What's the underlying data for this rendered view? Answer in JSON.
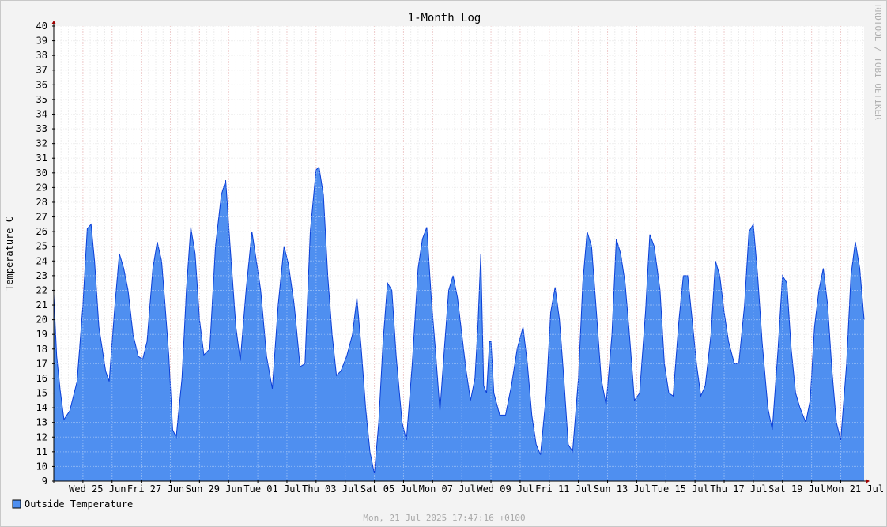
{
  "chart_data": {
    "type": "area",
    "title": "1-Month Log",
    "ylabel": "Temperature C",
    "xlabel": "",
    "ylim": [
      9,
      40
    ],
    "y_ticks": [
      9,
      10,
      11,
      12,
      13,
      14,
      15,
      16,
      17,
      18,
      19,
      20,
      21,
      22,
      23,
      24,
      25,
      26,
      27,
      28,
      29,
      30,
      31,
      32,
      33,
      34,
      35,
      36,
      37,
      38,
      39,
      40
    ],
    "x_range_days": [
      0,
      27.8
    ],
    "x_tick_labels": [
      {
        "day": 1.5,
        "label": "Wed 25 Jun"
      },
      {
        "day": 3.5,
        "label": "Fri 27 Jun"
      },
      {
        "day": 5.5,
        "label": "Sun 29 Jun"
      },
      {
        "day": 7.5,
        "label": "Tue 01 Jul"
      },
      {
        "day": 9.5,
        "label": "Thu 03 Jul"
      },
      {
        "day": 11.5,
        "label": "Sat 05 Jul"
      },
      {
        "day": 13.5,
        "label": "Mon 07 Jul"
      },
      {
        "day": 15.5,
        "label": "Wed 09 Jul"
      },
      {
        "day": 17.5,
        "label": "Fri 11 Jul"
      },
      {
        "day": 19.5,
        "label": "Sun 13 Jul"
      },
      {
        "day": 21.5,
        "label": "Tue 15 Jul"
      },
      {
        "day": 23.5,
        "label": "Thu 17 Jul"
      },
      {
        "day": 25.5,
        "label": "Sat 19 Jul"
      },
      {
        "day": 27.5,
        "label": "Mon 21 Jul"
      }
    ],
    "grid": true,
    "series": [
      {
        "name": "Outside Temperature",
        "color": "#4f8ff0",
        "outline": "#0a3fd8",
        "points": [
          [
            0.0,
            21.7
          ],
          [
            0.1,
            17.5
          ],
          [
            0.22,
            15.2
          ],
          [
            0.35,
            13.2
          ],
          [
            0.55,
            13.8
          ],
          [
            0.8,
            15.8
          ],
          [
            1.0,
            21.0
          ],
          [
            1.15,
            26.2
          ],
          [
            1.28,
            26.5
          ],
          [
            1.4,
            24.0
          ],
          [
            1.55,
            19.5
          ],
          [
            1.78,
            16.5
          ],
          [
            1.9,
            15.8
          ],
          [
            2.1,
            21.0
          ],
          [
            2.25,
            24.5
          ],
          [
            2.4,
            23.5
          ],
          [
            2.55,
            22.0
          ],
          [
            2.72,
            19.0
          ],
          [
            2.9,
            17.5
          ],
          [
            3.05,
            17.3
          ],
          [
            3.2,
            18.5
          ],
          [
            3.4,
            23.5
          ],
          [
            3.55,
            25.3
          ],
          [
            3.7,
            24.0
          ],
          [
            3.82,
            21.0
          ],
          [
            3.95,
            17.5
          ],
          [
            4.08,
            12.5
          ],
          [
            4.2,
            12.0
          ],
          [
            4.4,
            16.0
          ],
          [
            4.55,
            22.0
          ],
          [
            4.7,
            26.3
          ],
          [
            4.85,
            24.5
          ],
          [
            5.0,
            20.0
          ],
          [
            5.15,
            17.6
          ],
          [
            5.35,
            18.0
          ],
          [
            5.55,
            25.0
          ],
          [
            5.75,
            28.5
          ],
          [
            5.9,
            29.5
          ],
          [
            6.05,
            25.0
          ],
          [
            6.25,
            19.5
          ],
          [
            6.4,
            17.2
          ],
          [
            6.6,
            22.0
          ],
          [
            6.8,
            26.0
          ],
          [
            6.95,
            24.0
          ],
          [
            7.1,
            22.0
          ],
          [
            7.3,
            17.5
          ],
          [
            7.5,
            15.3
          ],
          [
            7.7,
            21.0
          ],
          [
            7.9,
            25.0
          ],
          [
            8.05,
            23.8
          ],
          [
            8.25,
            21.0
          ],
          [
            8.45,
            16.8
          ],
          [
            8.62,
            17.0
          ],
          [
            8.8,
            26.0
          ],
          [
            9.0,
            30.2
          ],
          [
            9.1,
            30.4
          ],
          [
            9.25,
            28.5
          ],
          [
            9.4,
            23.0
          ],
          [
            9.55,
            19.0
          ],
          [
            9.7,
            16.2
          ],
          [
            9.85,
            16.5
          ],
          [
            10.05,
            17.5
          ],
          [
            10.25,
            19.0
          ],
          [
            10.4,
            21.5
          ],
          [
            10.55,
            18.0
          ],
          [
            10.7,
            14.0
          ],
          [
            10.85,
            11.0
          ],
          [
            11.0,
            9.5
          ],
          [
            11.15,
            13.0
          ],
          [
            11.3,
            18.5
          ],
          [
            11.45,
            22.5
          ],
          [
            11.6,
            22.0
          ],
          [
            11.75,
            17.5
          ],
          [
            11.95,
            13.0
          ],
          [
            12.1,
            11.8
          ],
          [
            12.3,
            17.0
          ],
          [
            12.5,
            23.5
          ],
          [
            12.65,
            25.5
          ],
          [
            12.8,
            26.3
          ],
          [
            12.95,
            21.5
          ],
          [
            13.1,
            17.8
          ],
          [
            13.25,
            13.8
          ],
          [
            13.4,
            18.0
          ],
          [
            13.55,
            22.0
          ],
          [
            13.7,
            23.0
          ],
          [
            13.85,
            21.5
          ],
          [
            14.0,
            19.0
          ],
          [
            14.15,
            16.5
          ],
          [
            14.3,
            14.5
          ],
          [
            14.45,
            16.0
          ],
          [
            14.55,
            19.5
          ],
          [
            14.65,
            24.5
          ],
          [
            14.75,
            15.5
          ],
          [
            14.85,
            15.0
          ],
          [
            14.95,
            18.5
          ],
          [
            15.0,
            18.5
          ],
          [
            15.1,
            15.0
          ],
          [
            15.3,
            13.5
          ],
          [
            15.5,
            13.5
          ],
          [
            15.7,
            15.5
          ],
          [
            15.9,
            18.0
          ],
          [
            16.1,
            19.5
          ],
          [
            16.25,
            17.0
          ],
          [
            16.4,
            13.5
          ],
          [
            16.55,
            11.5
          ],
          [
            16.7,
            10.8
          ],
          [
            16.9,
            15.0
          ],
          [
            17.05,
            20.5
          ],
          [
            17.2,
            22.2
          ],
          [
            17.35,
            20.0
          ],
          [
            17.5,
            16.0
          ],
          [
            17.65,
            11.5
          ],
          [
            17.8,
            11.0
          ],
          [
            18.0,
            16.0
          ],
          [
            18.15,
            22.5
          ],
          [
            18.3,
            26.0
          ],
          [
            18.45,
            25.0
          ],
          [
            18.6,
            21.0
          ],
          [
            18.78,
            16.0
          ],
          [
            18.95,
            14.2
          ],
          [
            19.15,
            19.0
          ],
          [
            19.3,
            25.5
          ],
          [
            19.45,
            24.5
          ],
          [
            19.6,
            22.5
          ],
          [
            19.75,
            19.0
          ],
          [
            19.92,
            14.5
          ],
          [
            20.1,
            15.0
          ],
          [
            20.3,
            20.5
          ],
          [
            20.45,
            25.8
          ],
          [
            20.6,
            25.0
          ],
          [
            20.8,
            22.0
          ],
          [
            20.95,
            17.0
          ],
          [
            21.1,
            15.0
          ],
          [
            21.25,
            14.8
          ],
          [
            21.45,
            20.0
          ],
          [
            21.6,
            23.0
          ],
          [
            21.75,
            23.0
          ],
          [
            21.9,
            20.0
          ],
          [
            22.05,
            17.0
          ],
          [
            22.2,
            14.8
          ],
          [
            22.35,
            15.5
          ],
          [
            22.55,
            19.0
          ],
          [
            22.7,
            24.0
          ],
          [
            22.85,
            23.0
          ],
          [
            23.0,
            20.5
          ],
          [
            23.15,
            18.5
          ],
          [
            23.35,
            17.0
          ],
          [
            23.5,
            17.0
          ],
          [
            23.7,
            21.0
          ],
          [
            23.85,
            26.0
          ],
          [
            24.0,
            26.5
          ],
          [
            24.15,
            23.0
          ],
          [
            24.3,
            18.5
          ],
          [
            24.5,
            14.0
          ],
          [
            24.65,
            12.5
          ],
          [
            24.85,
            18.0
          ],
          [
            25.0,
            23.0
          ],
          [
            25.15,
            22.5
          ],
          [
            25.3,
            18.0
          ],
          [
            25.45,
            15.0
          ],
          [
            25.6,
            14.0
          ],
          [
            25.8,
            13.0
          ],
          [
            25.95,
            14.5
          ],
          [
            26.1,
            19.5
          ],
          [
            26.25,
            22.0
          ],
          [
            26.4,
            23.5
          ],
          [
            26.55,
            21.0
          ],
          [
            26.7,
            16.5
          ],
          [
            26.85,
            13.0
          ],
          [
            27.0,
            11.8
          ],
          [
            27.2,
            17.0
          ],
          [
            27.35,
            23.0
          ],
          [
            27.5,
            25.3
          ],
          [
            27.65,
            23.5
          ],
          [
            27.8,
            20.0
          ]
        ]
      }
    ],
    "legend_position": "bottom-left"
  },
  "credit": "RRDTOOL / TOBI OETIKER",
  "timestamp": "Mon, 21 Jul 2025 17:47:16 +0100"
}
